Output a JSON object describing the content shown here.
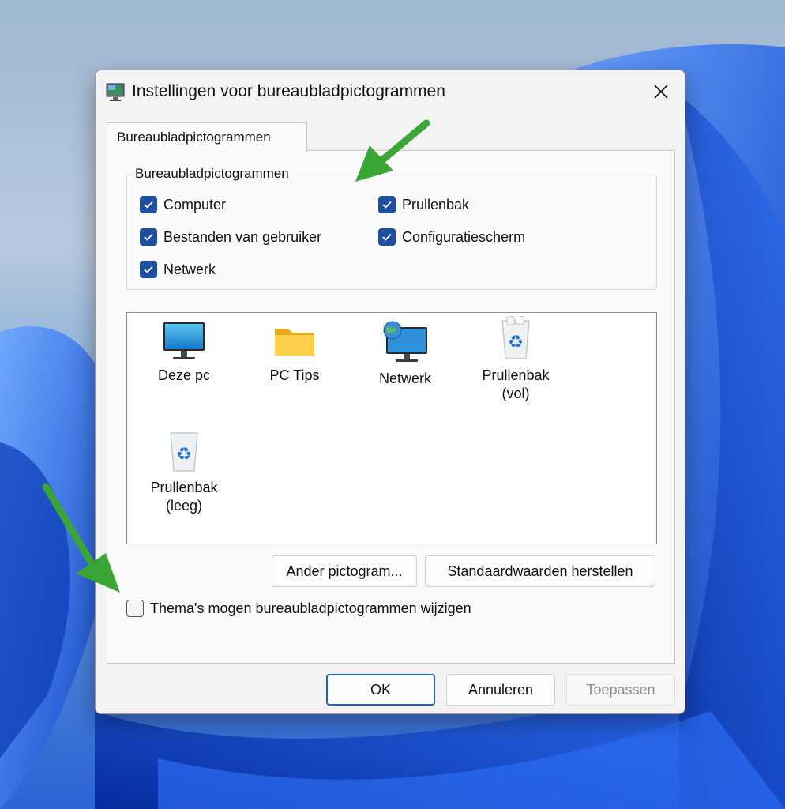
{
  "dialog": {
    "title": "Instellingen voor bureaubladpictogrammen",
    "icons": {
      "app": "desktop-settings-icon",
      "close": "close-icon"
    }
  },
  "tab": {
    "label": "Bureaubladpictogrammen"
  },
  "group": {
    "legend": "Bureaubladpictogrammen",
    "checkboxes": [
      {
        "label": "Computer",
        "checked": true
      },
      {
        "label": "Bestanden van gebruiker",
        "checked": true
      },
      {
        "label": "Netwerk",
        "checked": true
      },
      {
        "label": "Prullenbak",
        "checked": true
      },
      {
        "label": "Configuratiescherm",
        "checked": true
      }
    ]
  },
  "icon_list": {
    "items": [
      {
        "label": "Deze pc",
        "icon": "monitor-icon"
      },
      {
        "label": "PC Tips",
        "icon": "folder-icon"
      },
      {
        "label": "Netwerk",
        "icon": "network-globe-icon"
      },
      {
        "label": "Prullenbak\n(vol)",
        "icon": "recycle-bin-full-icon"
      },
      {
        "label": "Prullenbak\n(leeg)",
        "icon": "recycle-bin-empty-icon"
      }
    ]
  },
  "buttons": {
    "change_icon": "Ander pictogram...",
    "restore_default": "Standaardwaarden herstellen",
    "ok": "OK",
    "cancel": "Annuleren",
    "apply": "Toepassen"
  },
  "themes_checkbox": {
    "label": "Thema's mogen bureaubladpictogrammen wijzigen",
    "checked": false
  },
  "colors": {
    "accent": "#1d4fa3",
    "annotation_arrow": "#3aa635"
  }
}
